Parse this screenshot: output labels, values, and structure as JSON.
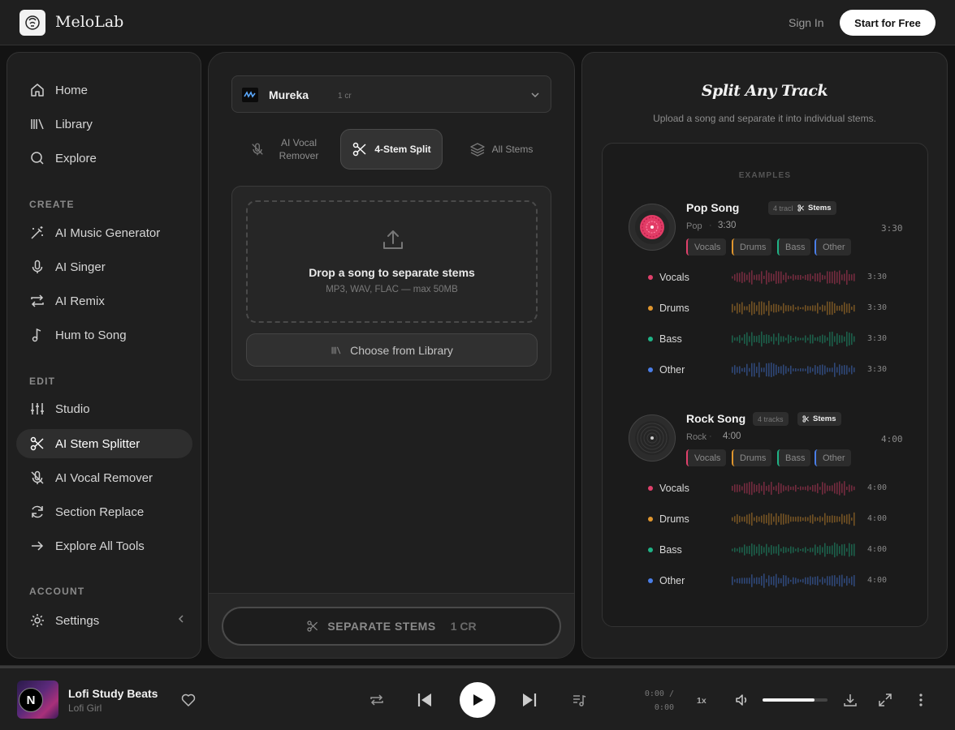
{
  "header": {
    "brand": "MeloLab",
    "sign_in": "Sign In",
    "start_free": "Start for Free"
  },
  "sidebar": {
    "main_items": [
      {
        "label": "Home",
        "icon": "home-icon"
      },
      {
        "label": "Library",
        "icon": "library-icon"
      },
      {
        "label": "Explore",
        "icon": "search-icon"
      }
    ],
    "create_title": "CREATE",
    "create_items": [
      {
        "label": "AI Music Generator",
        "icon": "magic-wand-icon"
      },
      {
        "label": "AI Singer",
        "icon": "microphone-icon"
      },
      {
        "label": "AI Remix",
        "icon": "remix-icon"
      },
      {
        "label": "Hum to Song",
        "icon": "music-note-icon"
      }
    ],
    "edit_title": "EDIT",
    "edit_items": [
      {
        "label": "Studio",
        "icon": "sliders-icon"
      },
      {
        "label": "AI Stem Splitter",
        "icon": "scissors-icon",
        "active": true
      },
      {
        "label": "AI Vocal Remover",
        "icon": "mic-off-icon"
      },
      {
        "label": "Section Replace",
        "icon": "refresh-icon"
      },
      {
        "label": "Explore All Tools",
        "icon": "arrow-right-icon"
      }
    ],
    "account_title": "ACCOUNT",
    "account_items": [
      {
        "label": "Settings",
        "icon": "gear-icon"
      }
    ]
  },
  "middle": {
    "model": {
      "name": "Mureka",
      "cost": "1 cr"
    },
    "tabs": [
      {
        "label_line1": "AI Vocal",
        "label_line2": "Remover",
        "icon": "mic-off-icon"
      },
      {
        "label": "4-Stem Split",
        "icon": "scissors-icon",
        "active": true
      },
      {
        "label": "All Stems",
        "icon": "layers-icon"
      }
    ],
    "upload": {
      "title": "Drop a song to separate stems",
      "subtitle": "MP3, WAV, FLAC — max 50MB",
      "library_button": "Choose from Library"
    },
    "action": {
      "label": "SEPARATE STEMS",
      "cost": "1 CR"
    }
  },
  "right": {
    "title": "Split Any Track",
    "subtitle": "Upload a song and separate it into individual stems.",
    "examples_title": "EXAMPLES",
    "songs": [
      {
        "name": "Pop Song",
        "tracks_badge": "4 tracks",
        "stems_badge": "Stems",
        "genre": "Pop",
        "duration": "3:30",
        "duration_right": "3:30",
        "chips": [
          "Vocals",
          "Drums",
          "Bass",
          "Other"
        ],
        "stems": [
          {
            "name": "Vocals",
            "duration": "3:30"
          },
          {
            "name": "Drums",
            "duration": "3:30"
          },
          {
            "name": "Bass",
            "duration": "3:30"
          },
          {
            "name": "Other",
            "duration": "3:30"
          }
        ]
      },
      {
        "name": "Rock Song",
        "tracks_badge": "4 tracks",
        "stems_badge": "Stems",
        "genre": "Rock",
        "duration": "4:00",
        "duration_right": "4:00",
        "chips": [
          "Vocals",
          "Drums",
          "Bass",
          "Other"
        ],
        "stems": [
          {
            "name": "Vocals",
            "duration": "4:00"
          },
          {
            "name": "Drums",
            "duration": "4:00"
          },
          {
            "name": "Bass",
            "duration": "4:00"
          },
          {
            "name": "Other",
            "duration": "4:00"
          }
        ]
      }
    ],
    "stem_colors": {
      "Vocals": "#e0406b",
      "Drums": "#e0962e",
      "Bass": "#1fb386",
      "Other": "#4a7ee8"
    }
  },
  "player": {
    "cover_letter": "N",
    "title": "Lofi Study Beats",
    "artist": "Lofi Girl",
    "time_current": "0:00 /",
    "time_total": "0:00",
    "speed": "1x",
    "volume": 0.8
  }
}
